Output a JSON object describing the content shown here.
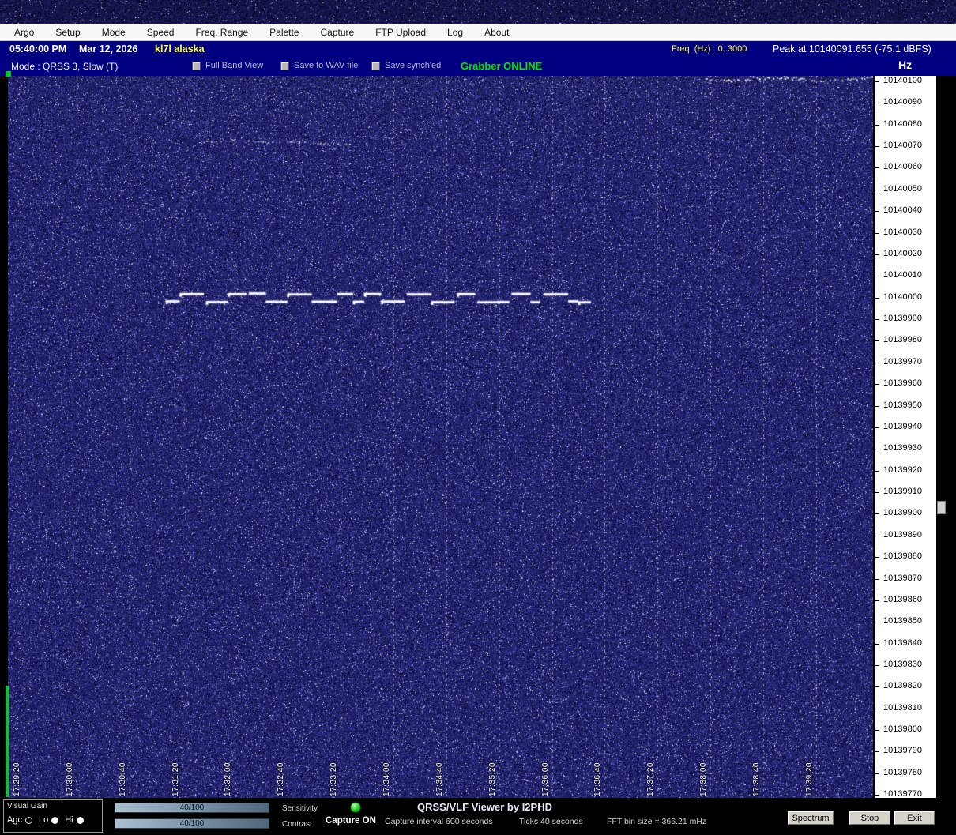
{
  "menu": {
    "items": [
      "Argo",
      "Setup",
      "Mode",
      "Speed",
      "Freq. Range",
      "Palette",
      "Capture",
      "FTP Upload",
      "Log",
      "About"
    ]
  },
  "status_bar": {
    "time": "05:40:00 PM",
    "date": "Mar 12, 2026",
    "callsign": "kl7l alaska",
    "freq_range_label": "Freq. (Hz) :  0..3000",
    "peak_label": "Peak at 10140091.655 (-75.1 dBFS)"
  },
  "mode_bar": {
    "mode_label": "Mode : QRSS 3, Slow  (T)",
    "checkboxes": [
      {
        "label": "Full Band View",
        "checked": false
      },
      {
        "label": "Save to WAV file",
        "checked": false
      },
      {
        "label": "Save synch'ed",
        "checked": false
      }
    ],
    "grabber_status": "Grabber ONLINE",
    "hz_label": "Hz"
  },
  "waterfall": {
    "time_labels": [
      "17:29:20",
      "17:30:00",
      "17:30:40",
      "17:31:20",
      "17:32:00",
      "17:32:40",
      "17:33:20",
      "17:34:00",
      "17:34:40",
      "17:35:20",
      "17:36:00",
      "17:36:40",
      "17:37:20",
      "17:38:00",
      "17:38:40",
      "17:39:20"
    ]
  },
  "freq_scale": {
    "unit": "Hz",
    "values": [
      "10140100",
      "10140090",
      "10140080",
      "10140070",
      "10140060",
      "10140050",
      "10140040",
      "10140030",
      "10140020",
      "10140010",
      "10140000",
      "10139990",
      "10139980",
      "10139970",
      "10139960",
      "10139950",
      "10139940",
      "10139930",
      "10139920",
      "10139910",
      "10139900",
      "10139890",
      "10139880",
      "10139870",
      "10139860",
      "10139850",
      "10139840",
      "10139830",
      "10139820",
      "10139810",
      "10139800",
      "10139790",
      "10139780",
      "10139770"
    ]
  },
  "bottom_bar": {
    "visual_gain_label": "Visual Gain",
    "radios": [
      {
        "label": "Agc",
        "on": false
      },
      {
        "label": "Lo",
        "on": true
      },
      {
        "label": "Hi",
        "on": true
      }
    ],
    "slider1_value": "40/100",
    "slider2_value": "40/100",
    "sensitivity_label": "Sensitivity",
    "contrast_label": "Contrast",
    "capture_status": "Capture ON",
    "app_title": "QRSS/VLF Viewer by I2PHD",
    "capture_interval": "Capture interval 600 seconds",
    "ticks_label": "Ticks  40 seconds",
    "fft_bin_label": "FFT bin size = 366.21 mHz",
    "buttons": [
      "Spectrum",
      "Stop",
      "Exit"
    ]
  },
  "colors": {
    "title_bar_navy": "#000080",
    "online_green": "#00e600",
    "accent_yellow": "#ffff33",
    "progress_green": "#00cc22",
    "waterfall_base": "#1a1a78"
  }
}
